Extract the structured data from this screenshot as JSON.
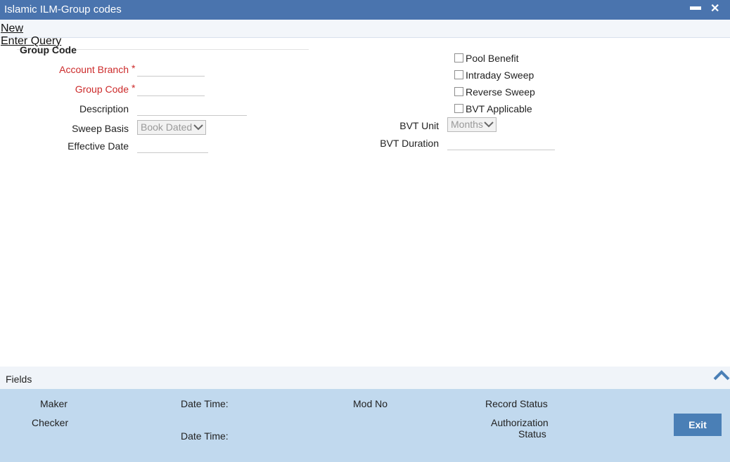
{
  "window": {
    "title": "Islamic ILM-Group codes",
    "minimize_symbol": "▬",
    "close_symbol": "✕"
  },
  "menu": {
    "new": "New",
    "enter_query": "Enter Query"
  },
  "section": {
    "title": "Group Code"
  },
  "form": {
    "account_branch_label": "Account Branch",
    "group_code_label": "Group Code",
    "description_label": "Description",
    "sweep_basis_label": "Sweep Basis",
    "sweep_basis_value": "Book Dated",
    "effective_date_label": "Effective Date",
    "required_marker": "*"
  },
  "options": {
    "pool_benefit": "Pool Benefit",
    "intraday_sweep": "Intraday Sweep",
    "reverse_sweep": "Reverse Sweep",
    "bvt_applicable": "BVT Applicable"
  },
  "bvt": {
    "unit_label": "BVT Unit",
    "unit_value": "Months",
    "duration_label": "BVT Duration"
  },
  "fields_bar": {
    "label": "Fields"
  },
  "footer": {
    "maker": "Maker",
    "checker": "Checker",
    "date_time": "Date Time:",
    "mod_no": "Mod No",
    "record_status": "Record Status",
    "authorization": "Authorization",
    "status": "Status",
    "exit": "Exit"
  },
  "icons": {
    "dropdown": "chevron-down-icon",
    "collapse": "chevron-up-icon"
  },
  "colors": {
    "titlebar": "#4a74ae",
    "footer": "#c1d9ee",
    "required": "#cc2a2a",
    "exit_button": "#4a7fb6"
  }
}
